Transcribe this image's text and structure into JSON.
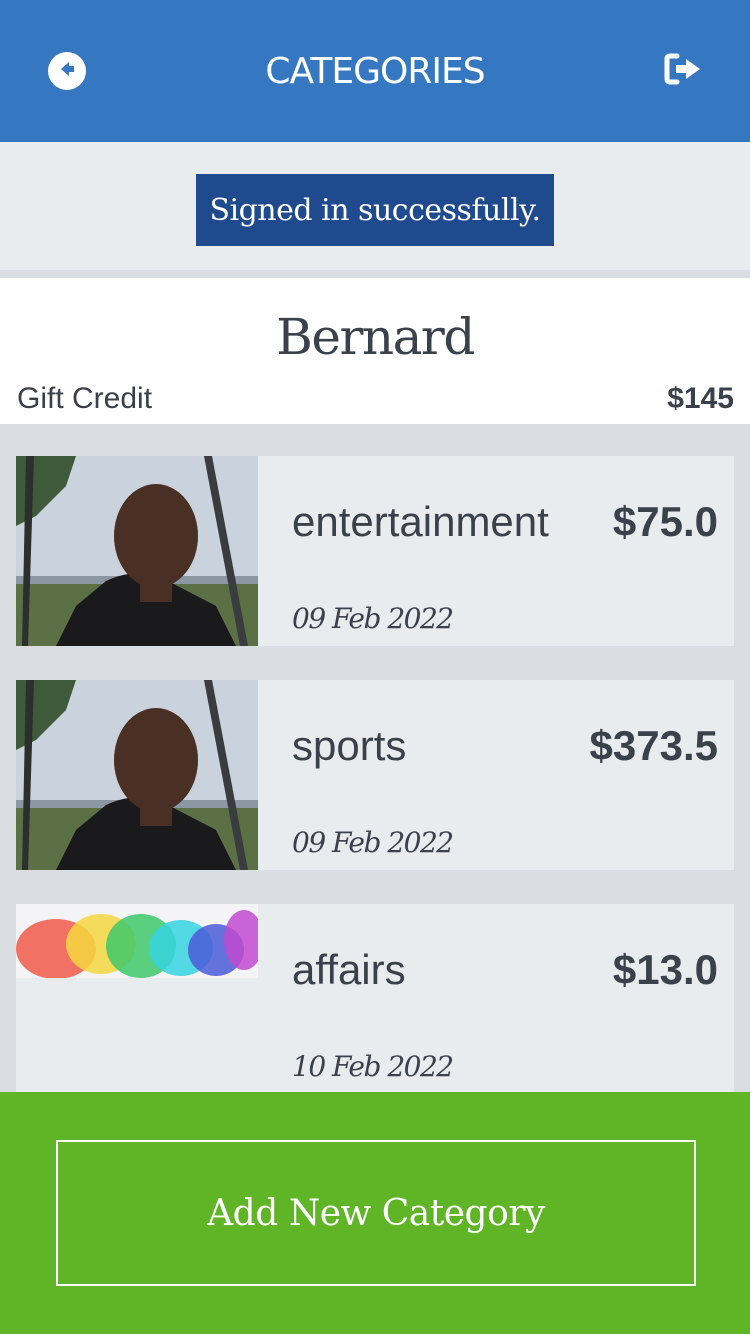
{
  "header": {
    "title": "CATEGORIES",
    "back_icon": "arrow-left-circle-icon",
    "logout_icon": "sign-out-icon",
    "color": "#3578c1"
  },
  "flash": {
    "message": "Signed in successfully.",
    "color": "#1f4b8e"
  },
  "user": {
    "name": "Bernard",
    "credit_label": "Gift Credit",
    "credit_value": "$145"
  },
  "categories": [
    {
      "name": "entertainment",
      "amount": "$75.0",
      "date": "09 Feb 2022",
      "image": "portrait-photo"
    },
    {
      "name": "sports",
      "amount": "$373.5",
      "date": "09 Feb 2022",
      "image": "portrait-photo"
    },
    {
      "name": "affairs",
      "amount": "$13.0",
      "date": "10 Feb 2022",
      "image": "colorful-smoke-photo"
    }
  ],
  "footer": {
    "add_label": "Add New Category",
    "color": "#5fb526"
  }
}
